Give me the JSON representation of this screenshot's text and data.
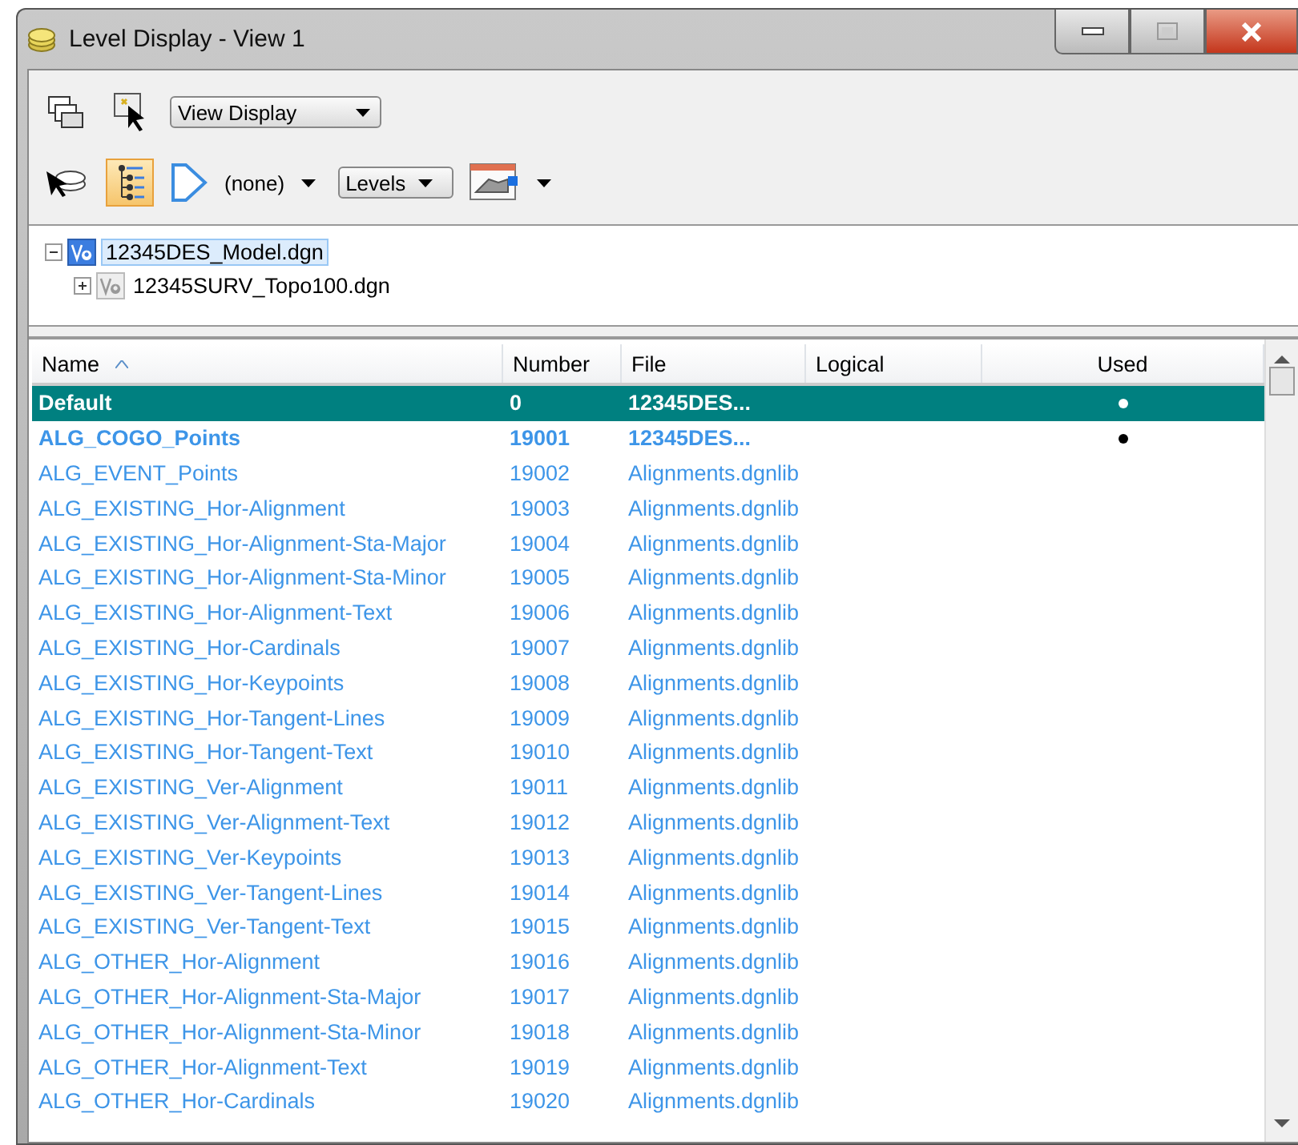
{
  "window": {
    "title": "Level Display - View 1"
  },
  "toolbar": {
    "view_dropdown": "View Display",
    "filter_label": "(none)",
    "levels_dropdown": "Levels",
    "tree_view_selected": true
  },
  "tree": [
    {
      "label": "12345DES_Model.dgn",
      "expanded": true,
      "selected": true,
      "children": [
        {
          "label": "12345SURV_Topo100.dgn",
          "expanded": false,
          "selected": false
        }
      ]
    }
  ],
  "table": {
    "columns": [
      "Name",
      "Number",
      "File",
      "Logical",
      "Used"
    ],
    "rows": [
      {
        "name": "Default",
        "number": "0",
        "file": "12345DES...",
        "used": true,
        "selected": true
      },
      {
        "name": "ALG_COGO_Points",
        "number": "19001",
        "file": "12345DES...",
        "used": true,
        "selected": false
      },
      {
        "name": "ALG_EVENT_Points",
        "number": "19002",
        "file": "Alignments.dgnlib",
        "used": false,
        "selected": false
      },
      {
        "name": "ALG_EXISTING_Hor-Alignment",
        "number": "19003",
        "file": "Alignments.dgnlib",
        "used": false,
        "selected": false
      },
      {
        "name": "ALG_EXISTING_Hor-Alignment-Sta-Major",
        "number": "19004",
        "file": "Alignments.dgnlib",
        "used": false,
        "selected": false
      },
      {
        "name": "ALG_EXISTING_Hor-Alignment-Sta-Minor",
        "number": "19005",
        "file": "Alignments.dgnlib",
        "used": false,
        "selected": false
      },
      {
        "name": "ALG_EXISTING_Hor-Alignment-Text",
        "number": "19006",
        "file": "Alignments.dgnlib",
        "used": false,
        "selected": false
      },
      {
        "name": "ALG_EXISTING_Hor-Cardinals",
        "number": "19007",
        "file": "Alignments.dgnlib",
        "used": false,
        "selected": false
      },
      {
        "name": "ALG_EXISTING_Hor-Keypoints",
        "number": "19008",
        "file": "Alignments.dgnlib",
        "used": false,
        "selected": false
      },
      {
        "name": "ALG_EXISTING_Hor-Tangent-Lines",
        "number": "19009",
        "file": "Alignments.dgnlib",
        "used": false,
        "selected": false
      },
      {
        "name": "ALG_EXISTING_Hor-Tangent-Text",
        "number": "19010",
        "file": "Alignments.dgnlib",
        "used": false,
        "selected": false
      },
      {
        "name": "ALG_EXISTING_Ver-Alignment",
        "number": "19011",
        "file": "Alignments.dgnlib",
        "used": false,
        "selected": false
      },
      {
        "name": "ALG_EXISTING_Ver-Alignment-Text",
        "number": "19012",
        "file": "Alignments.dgnlib",
        "used": false,
        "selected": false
      },
      {
        "name": "ALG_EXISTING_Ver-Keypoints",
        "number": "19013",
        "file": "Alignments.dgnlib",
        "used": false,
        "selected": false
      },
      {
        "name": "ALG_EXISTING_Ver-Tangent-Lines",
        "number": "19014",
        "file": "Alignments.dgnlib",
        "used": false,
        "selected": false
      },
      {
        "name": "ALG_EXISTING_Ver-Tangent-Text",
        "number": "19015",
        "file": "Alignments.dgnlib",
        "used": false,
        "selected": false
      },
      {
        "name": "ALG_OTHER_Hor-Alignment",
        "number": "19016",
        "file": "Alignments.dgnlib",
        "used": false,
        "selected": false
      },
      {
        "name": "ALG_OTHER_Hor-Alignment-Sta-Major",
        "number": "19017",
        "file": "Alignments.dgnlib",
        "used": false,
        "selected": false
      },
      {
        "name": "ALG_OTHER_Hor-Alignment-Sta-Minor",
        "number": "19018",
        "file": "Alignments.dgnlib",
        "used": false,
        "selected": false
      },
      {
        "name": "ALG_OTHER_Hor-Alignment-Text",
        "number": "19019",
        "file": "Alignments.dgnlib",
        "used": false,
        "selected": false
      },
      {
        "name": "ALG_OTHER_Hor-Cardinals",
        "number": "19020",
        "file": "Alignments.dgnlib",
        "used": false,
        "selected": false
      }
    ]
  }
}
